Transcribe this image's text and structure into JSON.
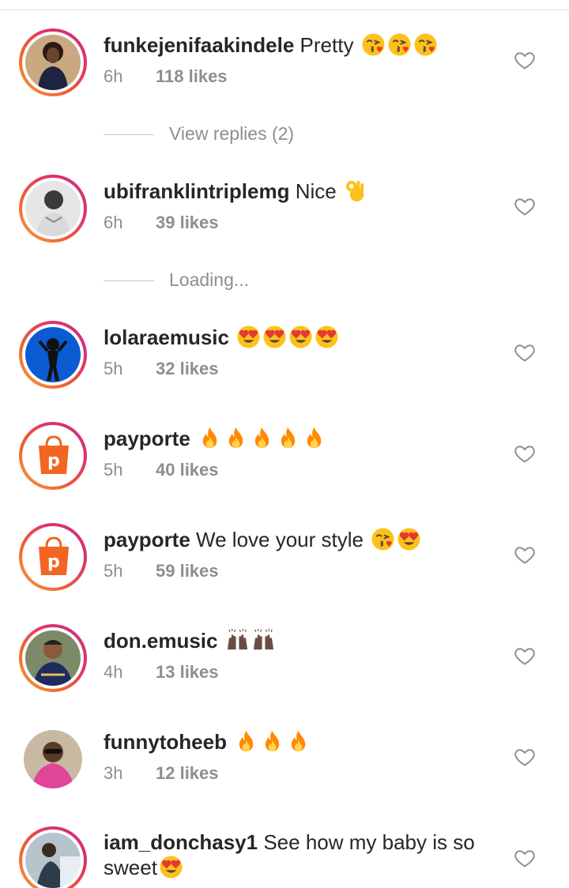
{
  "comments": [
    {
      "username": "funkejenifaakindele",
      "text": "Pretty ",
      "time": "6h",
      "likes": "118 likes"
    },
    {
      "username": "ubifranklintriplemg",
      "text": "Nice ",
      "time": "6h",
      "likes": "39 likes"
    },
    {
      "username": "lolaraemusic",
      "text": " ",
      "time": "5h",
      "likes": "32 likes"
    },
    {
      "username": "payporte",
      "text": " ",
      "time": "5h",
      "likes": "40 likes"
    },
    {
      "username": "payporte",
      "text": "We love your style ",
      "time": "5h",
      "likes": "59 likes"
    },
    {
      "username": "don.emusic",
      "text": " ",
      "time": "4h",
      "likes": "13 likes"
    },
    {
      "username": "funnytoheeb",
      "text": " ",
      "time": "3h",
      "likes": "12 likes"
    },
    {
      "username": "iam_donchasy1",
      "text": "See how my baby is so sweet",
      "time": "",
      "likes": ""
    }
  ],
  "replies": {
    "view_replies": "View replies (2)",
    "loading": "Loading..."
  },
  "colors": {
    "username": "#262626",
    "meta": "#8e8e8e",
    "ring_start": "#f9a13a",
    "ring_end": "#c13584",
    "brand_orange": "#f26522"
  },
  "icons": {
    "like": "heart-outline-icon"
  }
}
